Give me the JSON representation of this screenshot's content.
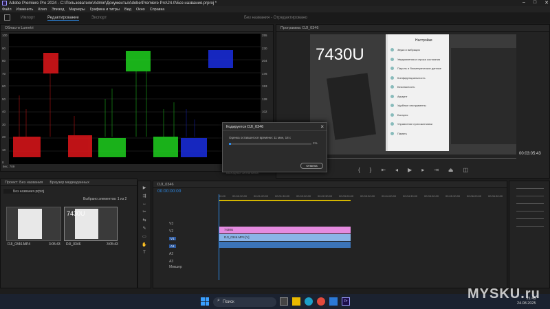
{
  "window": {
    "title": "Adobe Premiere Pro 2024 - C:\\Пользователи\\Admin\\Документы\\Adobe\\Premiere Pro\\24.0\\Без названия.prproj *"
  },
  "menu": [
    "Файл",
    "Изменить",
    "Клип",
    "Эпизод",
    "Маркеры",
    "Графика и титры",
    "Вид",
    "Окно",
    "Справка"
  ],
  "workspace": {
    "tabs": [
      "Импорт",
      "Редактирование",
      "Экспорт"
    ],
    "center_title": "Без названия - Отредактировано"
  },
  "scopes": {
    "header": "Области Lumetri",
    "left_ticks": [
      "100",
      "90",
      "80",
      "70",
      "60",
      "50",
      "40",
      "30",
      "20",
      "10",
      "0"
    ],
    "right_ticks": [
      "255",
      "230",
      "204",
      "178",
      "153",
      "128",
      "102",
      "76",
      "51",
      "26",
      "0"
    ],
    "footer_left": "8ес. 709",
    "footer_right": "Выходных сигнальных",
    "footer_hz": "Зажим (8 бит)"
  },
  "program": {
    "header": "Программа: DJI_0346",
    "overlay_label": "7430U",
    "timecode": "00:03:05:43",
    "settings_title": "Настройки",
    "settings_items": [
      "Звуки и вибрация",
      "Уведомления и строка состояния",
      "Пароль и биометрические данные",
      "Конфиденциальность",
      "Безопасность",
      "Аккаунт",
      "Удобные инструменты",
      "Батарея",
      "Управление приложениями",
      "Память"
    ]
  },
  "project": {
    "tabs": [
      "Проект: Без названия",
      "Браузер медиаданных"
    ],
    "project_name": "Без названия.prproj",
    "selected": "Выбрано элементов: 1 из 2",
    "items": [
      {
        "name": "DJI_0346.MP4",
        "duration": "3:05:43",
        "label": ""
      },
      {
        "name": "DJI_0346",
        "duration": "3:05:43",
        "label": "7430U"
      }
    ]
  },
  "timeline": {
    "tab": "DJI_0346",
    "timecode": "00:00:00:00",
    "ruler": [
      "00:00",
      "00:00:30:00",
      "00:01:00:00",
      "00:01:30:00",
      "00:02:00:00",
      "00:02:30:00",
      "00:03:00:00",
      "00:03:30:00",
      "00:04:00:00",
      "00:04:30:00",
      "00:05:00:00",
      "00:05:30:00",
      "00:06:00:00",
      "00:06:30:00"
    ],
    "video_tracks": [
      "V3",
      "V2",
      "V1"
    ],
    "audio_tracks": [
      "A1",
      "A2",
      "A3"
    ],
    "mix_label": "Микшер",
    "clips": {
      "title_clip": "7430U",
      "video_clip": "DJI_0346.MP4 [V]"
    }
  },
  "dialog": {
    "title": "Кодируется DJI_0346",
    "estimate": "Оценка оставшегося времени: 11 мин, 18 с",
    "percent": "1%",
    "progress": 0.01,
    "cancel": "Отмена"
  },
  "taskbar": {
    "search_placeholder": "Поиск",
    "time": "21:45",
    "date": "24.08.2025"
  },
  "watermark": "MYSKU.ru"
}
